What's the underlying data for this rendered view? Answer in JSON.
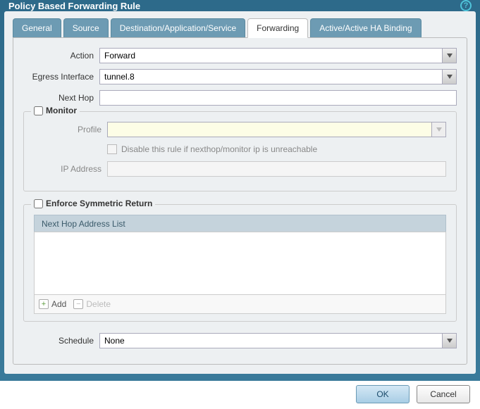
{
  "title": "Policy Based Forwarding Rule",
  "tabs": [
    "General",
    "Source",
    "Destination/Application/Service",
    "Forwarding",
    "Active/Active HA Binding"
  ],
  "activeTab": "Forwarding",
  "fields": {
    "action_label": "Action",
    "action_value": "Forward",
    "egress_label": "Egress Interface",
    "egress_value": "tunnel.8",
    "nexthop_label": "Next Hop",
    "nexthop_value": ""
  },
  "monitor": {
    "legend": "Monitor",
    "checked": false,
    "profile_label": "Profile",
    "profile_value": "",
    "disable_label": "Disable this rule if nexthop/monitor ip is unreachable",
    "disable_checked": false,
    "ip_label": "IP Address",
    "ip_value": ""
  },
  "symret": {
    "legend": "Enforce Symmetric Return",
    "checked": false,
    "list_header": "Next Hop Address List",
    "add_label": "Add",
    "delete_label": "Delete"
  },
  "schedule": {
    "label": "Schedule",
    "value": "None"
  },
  "buttons": {
    "ok": "OK",
    "cancel": "Cancel"
  }
}
